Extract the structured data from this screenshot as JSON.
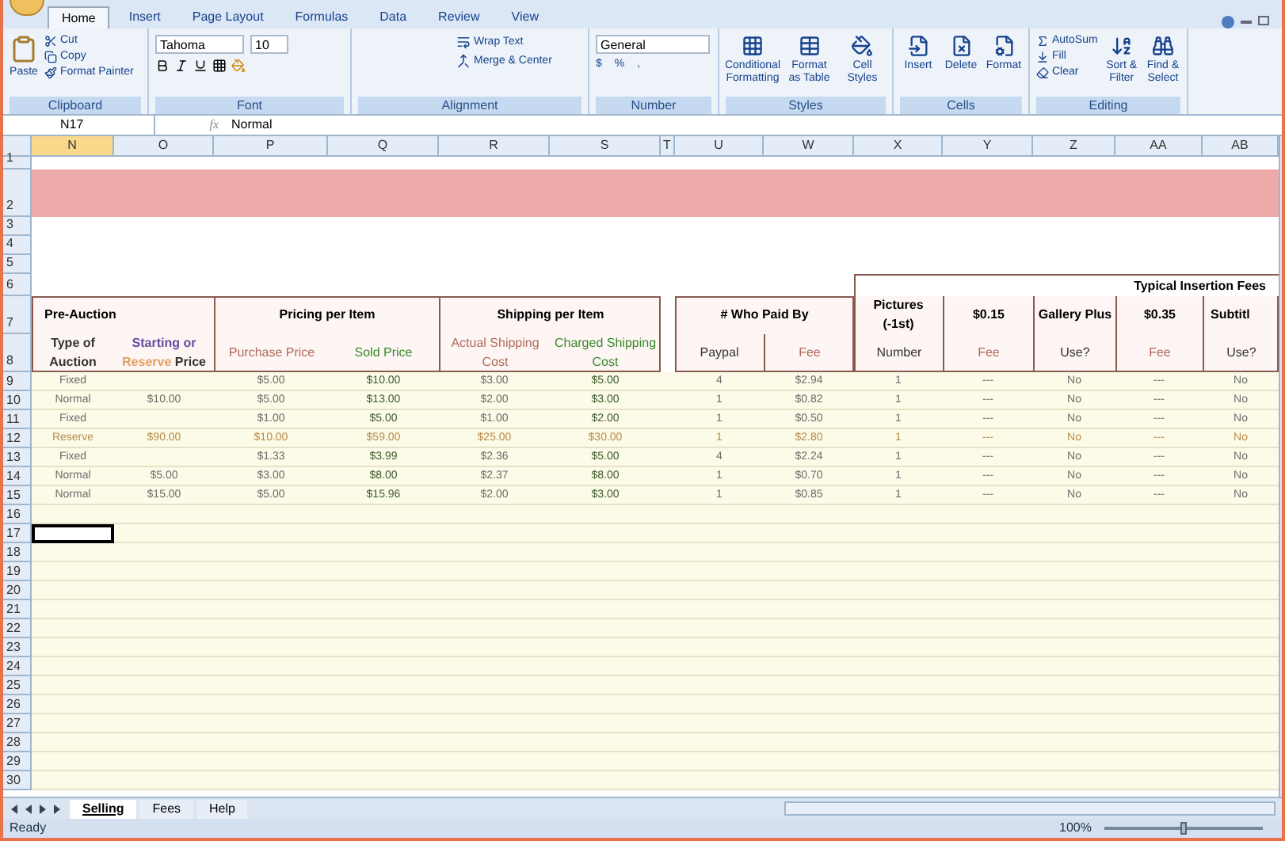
{
  "ribbon_tabs": [
    {
      "label": "Home",
      "selected": true
    },
    {
      "label": "Insert",
      "selected": false
    },
    {
      "label": "Page Layout",
      "selected": false
    },
    {
      "label": "Formulas",
      "selected": false
    },
    {
      "label": "Data",
      "selected": false
    },
    {
      "label": "Review",
      "selected": false
    },
    {
      "label": "View",
      "selected": false
    }
  ],
  "clipboard": {
    "paste": "Paste",
    "cut": "Cut",
    "copy": "Copy",
    "painter": "Format Painter",
    "label": "Clipboard"
  },
  "font": {
    "name": "Tahoma",
    "size": "10",
    "label": "Font"
  },
  "alignment": {
    "wrap": "Wrap Text",
    "merge": "Merge & Center",
    "label": "Alignment"
  },
  "number": {
    "format": "General",
    "currency": "$",
    "percent": "%",
    "comma": ",",
    "label": "Number"
  },
  "styles": {
    "items": [
      "Conditional Formatting",
      "Format as Table",
      "Cell Styles"
    ],
    "label": "Styles"
  },
  "cells": {
    "items": [
      "Insert",
      "Delete",
      "Format"
    ],
    "label": "Cells"
  },
  "editing": {
    "autosum": "AutoSum",
    "fill": "Fill",
    "clear": "Clear",
    "sort": "Sort & Filter",
    "find": "Find & Select",
    "label": "Editing"
  },
  "formula_bar": {
    "name_box": "N17",
    "fx": "fx",
    "value": "Normal"
  },
  "columns": [
    "N",
    "O",
    "P",
    "Q",
    "R",
    "S",
    "T",
    "U",
    "W",
    "X",
    "Y",
    "Z",
    "AA",
    "AB"
  ],
  "header_rows": [
    "1",
    "2",
    "3",
    "4",
    "5",
    "6",
    "7",
    "8"
  ],
  "header": {
    "fees_title": "Typical Insertion Fees",
    "pre_auction": "Pre-Auction",
    "pricing": "Pricing per Item",
    "shipping": "Shipping per Item",
    "paid_by": "# Who Paid By",
    "pictures": "Pictures (-1st)",
    "price_a": "$0.15",
    "gallery": "Gallery Plus",
    "price_b": "$0.35",
    "subtitle": "Subtitl",
    "sub": [
      "Type of Auction",
      "Purchase Price",
      "Sold Price",
      "Actual Shipping Cost",
      "Charged Shipping Cost",
      "Paypal",
      "Fee",
      "Number",
      "Fee",
      "Use?",
      "Fee",
      "Use?"
    ],
    "starting": [
      {
        "text": "Starting or ",
        "kind": "plain"
      },
      {
        "text": "Reserve",
        "kind": "accent"
      },
      {
        "text": " Price",
        "kind": "dark"
      }
    ]
  },
  "rows": [
    {
      "number": "9",
      "kind": "normal",
      "cells": [
        "Fixed",
        "",
        "$5.00",
        "$10.00",
        "$3.00",
        "$5.00",
        "",
        "4",
        "$2.94",
        "1",
        "---",
        "No",
        "---",
        "No"
      ]
    },
    {
      "number": "10",
      "kind": "normal",
      "cells": [
        "Normal",
        "$10.00",
        "$5.00",
        "$13.00",
        "$2.00",
        "$3.00",
        "",
        "1",
        "$0.82",
        "1",
        "---",
        "No",
        "---",
        "No"
      ]
    },
    {
      "number": "11",
      "kind": "normal",
      "cells": [
        "Fixed",
        "",
        "$1.00",
        "$5.00",
        "$1.00",
        "$2.00",
        "",
        "1",
        "$0.50",
        "1",
        "---",
        "No",
        "---",
        "No"
      ]
    },
    {
      "number": "12",
      "kind": "reserve",
      "cells": [
        "Reserve",
        "$90.00",
        "$10.00",
        "$59.00",
        "$25.00",
        "$30.00",
        "",
        "1",
        "$2.80",
        "1",
        "---",
        "No",
        "---",
        "No"
      ]
    },
    {
      "number": "13",
      "kind": "normal",
      "cells": [
        "Fixed",
        "",
        "$1.33",
        "$3.99",
        "$2.36",
        "$5.00",
        "",
        "4",
        "$2.24",
        "1",
        "---",
        "No",
        "---",
        "No"
      ]
    },
    {
      "number": "14",
      "kind": "normal",
      "cells": [
        "Normal",
        "$5.00",
        "$3.00",
        "$8.00",
        "$2.37",
        "$8.00",
        "",
        "1",
        "$0.70",
        "1",
        "---",
        "No",
        "---",
        "No"
      ]
    },
    {
      "number": "15",
      "kind": "normal",
      "cells": [
        "Normal",
        "$15.00",
        "$5.00",
        "$15.96",
        "$2.00",
        "$3.00",
        "",
        "1",
        "$0.85",
        "1",
        "---",
        "No",
        "---",
        "No"
      ]
    }
  ],
  "blank_rows": [
    {
      "number": "16",
      "selected": false
    },
    {
      "number": "17",
      "selected": true
    },
    {
      "number": "18",
      "selected": false
    },
    {
      "number": "19",
      "selected": false
    },
    {
      "number": "20",
      "selected": false
    },
    {
      "number": "21",
      "selected": false
    },
    {
      "number": "22",
      "selected": false
    },
    {
      "number": "23",
      "selected": false
    },
    {
      "number": "24",
      "selected": false
    },
    {
      "number": "25",
      "selected": false
    },
    {
      "number": "26",
      "selected": false
    },
    {
      "number": "27",
      "selected": false
    },
    {
      "number": "28",
      "selected": false
    },
    {
      "number": "29",
      "selected": false
    },
    {
      "number": "30",
      "selected": false
    }
  ],
  "sheet_tabs": [
    {
      "label": "Selling",
      "selected": true
    },
    {
      "label": "Fees",
      "selected": false
    },
    {
      "label": "Help",
      "selected": false
    }
  ],
  "status_bar": {
    "text": "Ready",
    "zoom": "100%",
    "zoom_level": {
      "level": 0.5
    }
  }
}
